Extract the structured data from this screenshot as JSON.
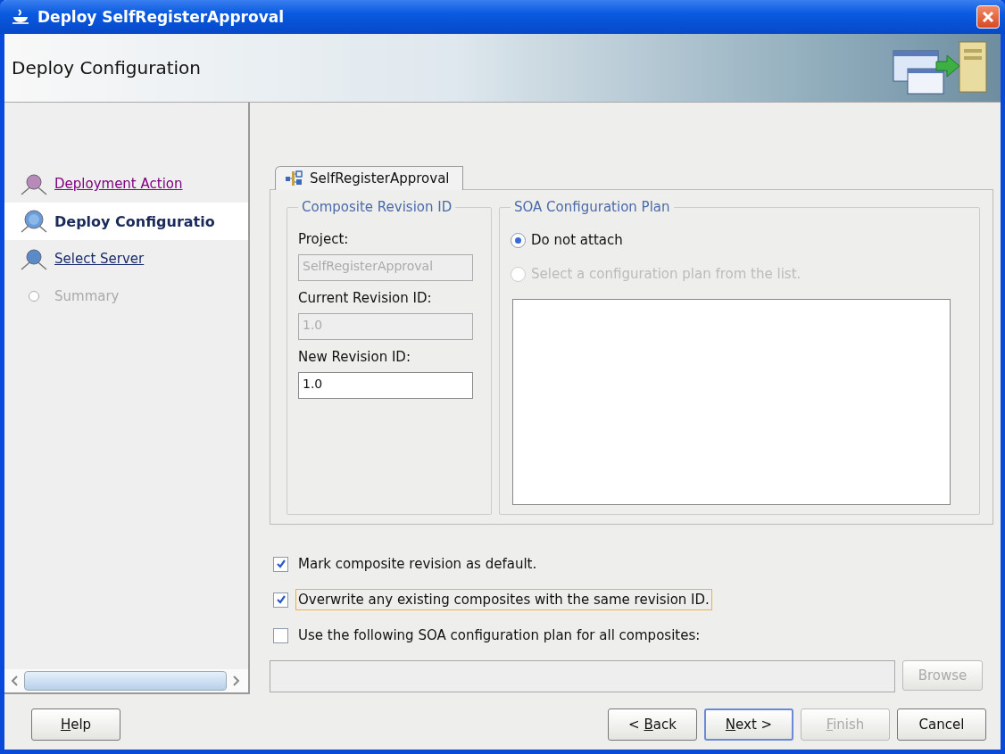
{
  "window": {
    "title": "Deploy SelfRegisterApproval"
  },
  "header": {
    "title": "Deploy Configuration"
  },
  "steps": [
    {
      "label": "Deployment Action",
      "kind": "visited",
      "selected": false
    },
    {
      "label": "Deploy Configuratio",
      "kind": "current",
      "selected": true
    },
    {
      "label": "Select Server",
      "kind": "link",
      "selected": false
    },
    {
      "label": "Summary",
      "kind": "disabled",
      "selected": false
    }
  ],
  "tab": {
    "label": "SelfRegisterApproval",
    "selected": true
  },
  "revision_group": {
    "title": "Composite Revision ID",
    "fields": [
      {
        "label": "Project:",
        "value": "SelfRegisterApproval",
        "disabled": true
      },
      {
        "label": "Current Revision ID:",
        "value": "1.0",
        "disabled": true
      },
      {
        "label": "New Revision ID:",
        "value": "1.0",
        "disabled": false
      }
    ]
  },
  "plan_group": {
    "title": "SOA Configuration Plan",
    "options": [
      {
        "label": "Do not attach",
        "selected": true,
        "disabled": false
      },
      {
        "label": "Select a configuration plan from the list.",
        "selected": false,
        "disabled": true
      }
    ]
  },
  "checkboxes": [
    {
      "label": "Mark composite revision as default.",
      "checked": true,
      "focused": false
    },
    {
      "label": "Overwrite any existing composites with the same revision ID.",
      "checked": true,
      "focused": true
    },
    {
      "label": "Use the following SOA configuration plan for all composites:",
      "checked": false,
      "focused": false
    }
  ],
  "plan_path": {
    "disabled": true
  },
  "browse_button": {
    "label": "Browse",
    "disabled": true
  },
  "help_button": {
    "key": "H",
    "after": "elp"
  },
  "buttons": [
    {
      "before": "< ",
      "key": "B",
      "after": "ack",
      "disabled": false,
      "default": false
    },
    {
      "key": "N",
      "after": "ext >",
      "disabled": false,
      "default": true
    },
    {
      "key": "F",
      "after": "inish",
      "disabled": true,
      "default": false
    },
    {
      "before": "Cancel",
      "disabled": false,
      "default": false
    }
  ]
}
